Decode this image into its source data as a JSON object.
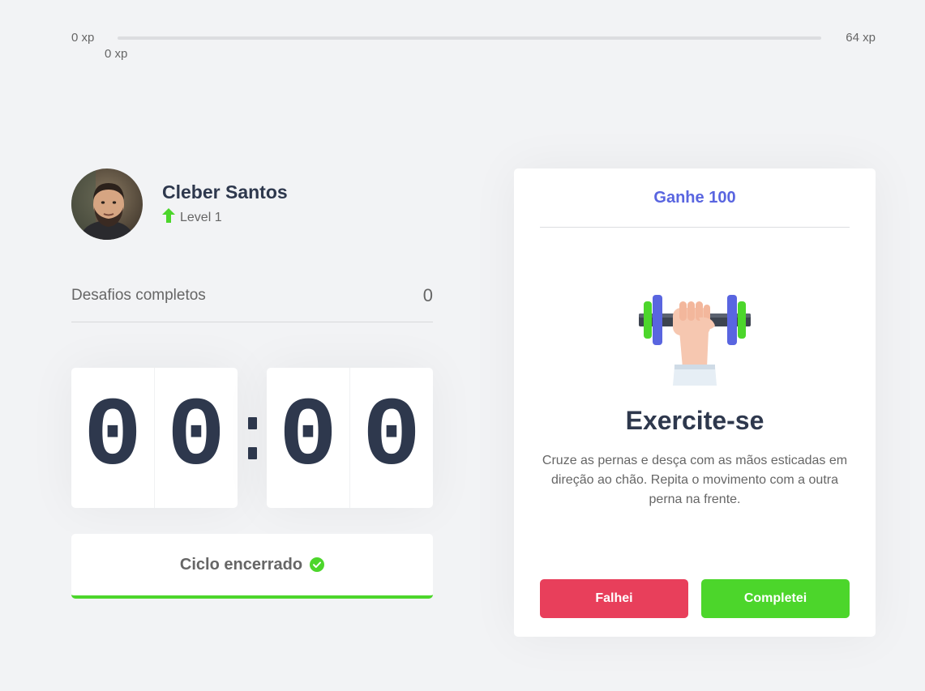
{
  "xp": {
    "min_label": "0 xp",
    "max_label": "64 xp",
    "current_label": "0 xp",
    "progress": 0
  },
  "profile": {
    "name": "Cleber Santos",
    "level_label": "Level 1"
  },
  "completed": {
    "label": "Desafios completos",
    "count": "0"
  },
  "countdown": {
    "minute_left": "0",
    "minute_right": "0",
    "second_left": "0",
    "second_right": "0"
  },
  "cycle": {
    "label": "Ciclo encerrado"
  },
  "challenge": {
    "header": "Ganhe 100",
    "title": "Exercite-se",
    "description": "Cruze as pernas e desça com as mãos esticadas em direção ao chão. Repita o movimento com a outra perna na frente.",
    "fail_label": "Falhei",
    "success_label": "Completei"
  },
  "colors": {
    "background": "#f2f3f5",
    "green": "#4cd62b",
    "red": "#e83f5b",
    "blue": "#5965e0",
    "title": "#2e384d",
    "text": "#666666"
  },
  "icons": {
    "level": "arrow-up-icon",
    "cycle_done": "check-circle-icon",
    "challenge": "dumbbell-icon"
  }
}
